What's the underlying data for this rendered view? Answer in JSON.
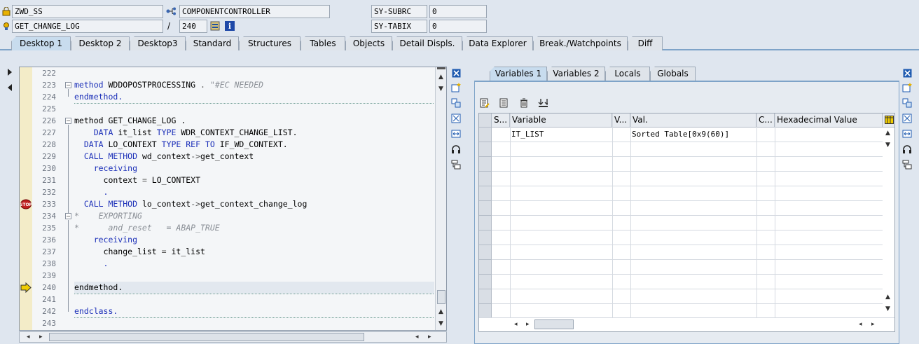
{
  "header": {
    "program_field": "ZWD_SS",
    "include_field": "COMPONENTCONTROLLER",
    "method_field": "GET_CHANGE_LOG",
    "slash": "/",
    "line_field": "240",
    "sysvar1_name": "SY-SUBRC",
    "sysvar1_value": "0",
    "sysvar2_name": "SY-TABIX",
    "sysvar2_value": "0"
  },
  "tabs": [
    {
      "label": "Desktop 1",
      "active": true
    },
    {
      "label": "Desktop 2"
    },
    {
      "label": "Desktop3"
    },
    {
      "label": "Standard"
    },
    {
      "label": "Structures"
    },
    {
      "label": "Tables"
    },
    {
      "label": "Objects"
    },
    {
      "label": "Detail Displs."
    },
    {
      "label": "Data Explorer"
    },
    {
      "label": "Break./Watchpoints"
    },
    {
      "label": "Diff"
    }
  ],
  "editor": {
    "line_numbers": [
      "222",
      "223",
      "224",
      "225",
      "226",
      "227",
      "228",
      "229",
      "230",
      "231",
      "232",
      "233",
      "234",
      "235",
      "236",
      "237",
      "238",
      "239",
      "240",
      "241",
      "242",
      "243"
    ],
    "current_line": "240",
    "breakpoint_line": "233",
    "code": {
      "l223_kw": "method",
      "l223_name": " WDDOPOSTPROCESSING",
      "l223_dot": " .",
      "l223_cm": " \"#EC NEEDED",
      "l224": "endmethod.",
      "l226_kw": "method",
      "l226_name": " GET_CHANGE_LOG .",
      "l227_kw1": "    DATA",
      "l227_mid": " it_list ",
      "l227_kw2": "TYPE",
      "l227_end": " WDR_CONTEXT_CHANGE_LIST.",
      "l228_kw1": "  DATA",
      "l228_mid": " LO_CONTEXT ",
      "l228_kw2": "TYPE REF TO",
      "l228_end": " IF_WD_CONTEXT.",
      "l229_kw": "  CALL METHOD",
      "l229_obj": " wd_context",
      "l229_op": "->",
      "l229_end": "get_context",
      "l230_kw": "    receiving",
      "l231_a": "      context ",
      "l231_op": "=",
      "l231_b": " LO_CONTEXT",
      "l232": "      .",
      "l233_kw": "  CALL METHOD",
      "l233_obj": " lo_context",
      "l233_op": "->",
      "l233_end": "get_context_change_log",
      "l234_cm": "*    EXPORTING",
      "l235_cm": "*      and_reset   = ABAP_TRUE",
      "l236_kw": "    receiving",
      "l237_a": "      change_list ",
      "l237_op": "=",
      "l237_b": " it_list",
      "l238": "      .",
      "l240": "endmethod.",
      "l242": "endclass."
    }
  },
  "variables": {
    "tabs": [
      {
        "label": "Variables 1",
        "active": true
      },
      {
        "label": "Variables 2"
      },
      {
        "label": "Locals"
      },
      {
        "label": "Globals"
      }
    ],
    "columns": [
      "S...",
      "Variable",
      "V...",
      "Val.",
      "C...",
      "Hexadecimal Value"
    ],
    "rows": [
      {
        "variable": "IT_LIST",
        "value": "Sorted Table[0x9(60)]"
      }
    ]
  },
  "icons": {
    "top_left": [
      "folder-lock-icon",
      "gear-icon",
      "hierarchy-icon",
      "stack-icon",
      "info-icon"
    ],
    "side_left": [
      "expand-right-icon",
      "collapse-left-icon"
    ],
    "side_mid": [
      "close-icon",
      "new-icon",
      "swap-icon",
      "maximize-icon",
      "full-width-icon",
      "headset-icon",
      "layout-icon"
    ],
    "side_right": [
      "close-icon",
      "new-icon",
      "swap-icon",
      "maximize-icon",
      "full-width-icon",
      "headset-icon",
      "layout-icon"
    ],
    "var_toolbar": [
      "change-icon",
      "detail-icon",
      "delete-icon",
      "sort-icon"
    ]
  },
  "colors": {
    "keyword": "#1b2fb8",
    "comment": "#8a8f96",
    "tab_active": "#c8dcee",
    "breakpoint": "#c02020",
    "current_line_arrow": "#e8c000"
  }
}
